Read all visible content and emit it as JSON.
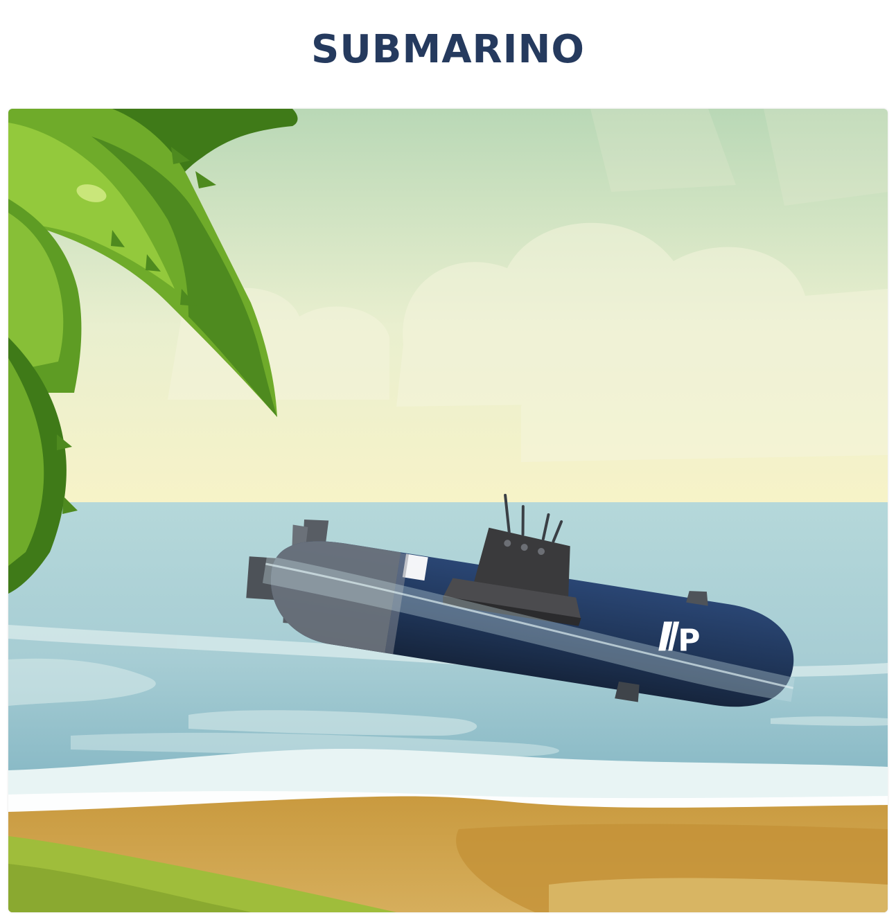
{
  "page": {
    "title": "SUBMARINO"
  },
  "scene": {
    "subject": "submarine",
    "logo_letter": "P"
  },
  "colors": {
    "title": "#253a5e",
    "sky_top": "#b9d8b6",
    "sky_bottom": "#f6f3cf",
    "sea": "#a9cfd6",
    "sea_deep": "#7fb6c4",
    "foam": "#e6f4f6",
    "sand": "#c89b42",
    "sand_light": "#d8b463",
    "grass": "#9dbb3c",
    "palm_dark": "#4e8a1f",
    "palm_mid": "#6fac2a",
    "palm_light": "#93c93c",
    "hull": "#1f3558",
    "hull_dark": "#17263f",
    "tower": "#3a3a3c",
    "tower_top": "#545456",
    "fin_gray": "#5a5f66"
  }
}
